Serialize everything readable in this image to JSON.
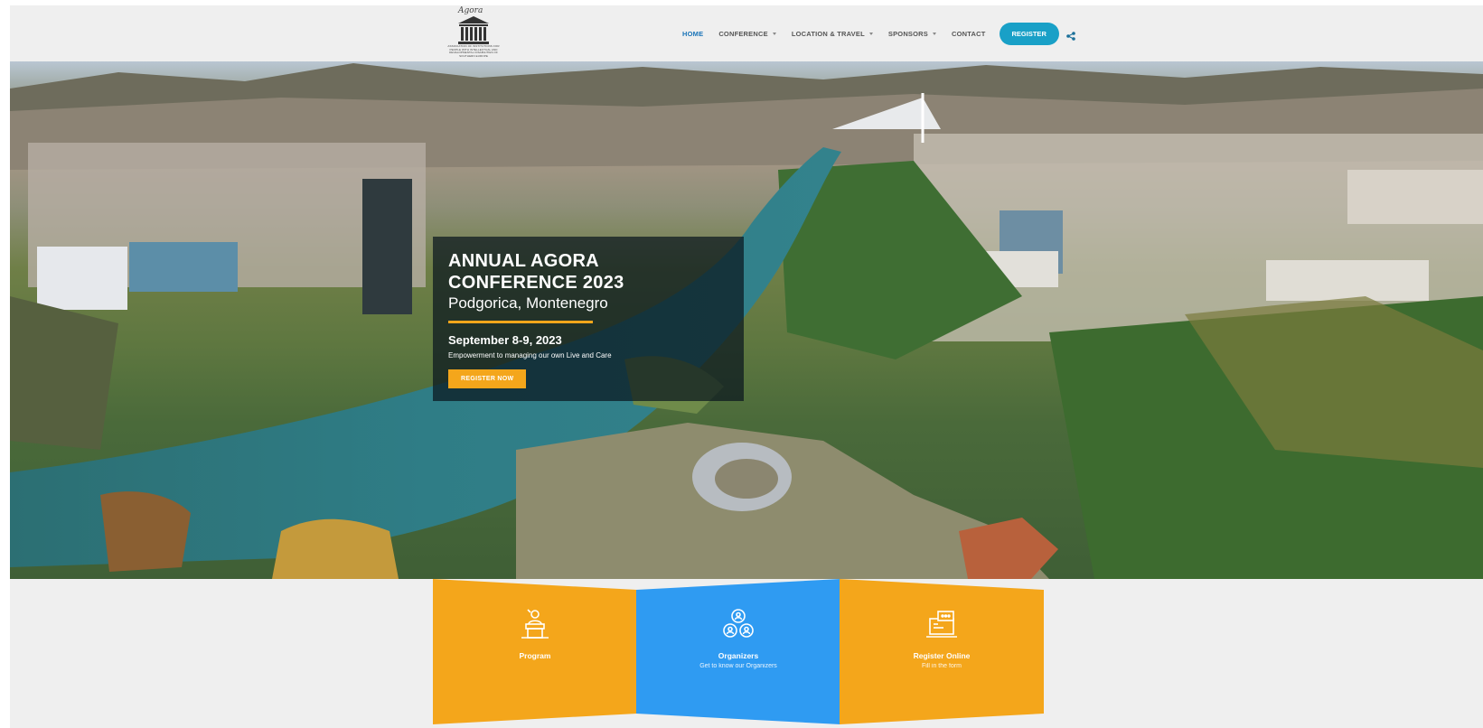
{
  "logo": {
    "script": "Agora",
    "fine_print": "ASSOCIATION OF INSTITUTIONS FOR PEOPLE WITH INTELLECTUAL AND DEVELOPMENTAL DISABILITIES OF SOUTHERN EUROPE"
  },
  "nav": {
    "items": [
      {
        "label": "HOME",
        "active": true,
        "dropdown": false
      },
      {
        "label": "CONFERENCE",
        "active": false,
        "dropdown": true
      },
      {
        "label": "LOCATION & TRAVEL",
        "active": false,
        "dropdown": true
      },
      {
        "label": "SPONSORS",
        "active": false,
        "dropdown": true
      },
      {
        "label": "CONTACT",
        "active": false,
        "dropdown": false
      }
    ],
    "register_label": "REGISTER",
    "share_icon": "share-icon"
  },
  "hero": {
    "title_line1": "ANNUAL AGORA",
    "title_line2": "CONFERENCE 2023",
    "city": "Podgorica, Montenegro",
    "date": "September 8-9, 2023",
    "subtitle": "Empowerment to managing our own Live and Care",
    "button_label": "REGISTER NOW"
  },
  "cards": [
    {
      "title": "Program",
      "subtitle": "",
      "icon": "speaker-podium-icon",
      "color": "#f4a61b"
    },
    {
      "title": "Organizers",
      "subtitle": "Get to know our Organizers",
      "icon": "people-network-icon",
      "color": "#2f9bf2"
    },
    {
      "title": "Register Online",
      "subtitle": "Fill in the form",
      "icon": "laptop-chat-icon",
      "color": "#f4a61b"
    }
  ],
  "colors": {
    "accent_orange": "#f4a61b",
    "accent_blue": "#2f9bf2",
    "nav_active": "#1a74b8",
    "register_button": "#19a0c7"
  }
}
